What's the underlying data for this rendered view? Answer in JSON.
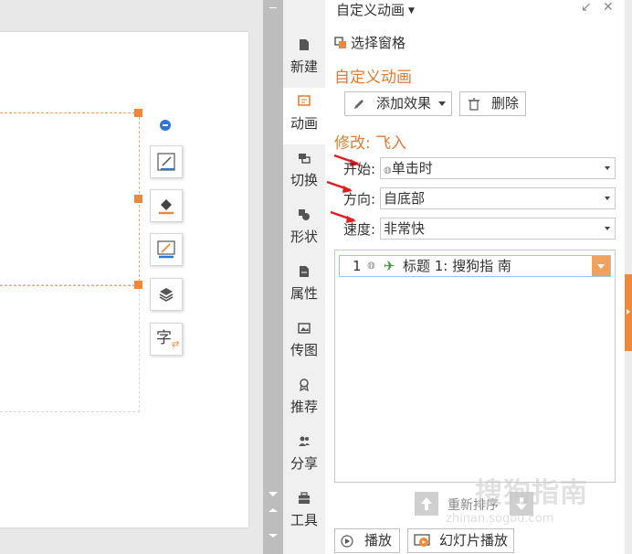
{
  "colors": {
    "accent": "#e07b31",
    "handle": "#f0883a",
    "focus": "#9ec3f0",
    "annotation": "#e02020"
  },
  "tabs": [
    {
      "label": "新建",
      "icon": "file-icon"
    },
    {
      "label": "动画",
      "icon": "animation-icon",
      "active": true
    },
    {
      "label": "切换",
      "icon": "transition-icon"
    },
    {
      "label": "形状",
      "icon": "shapes-icon"
    },
    {
      "label": "属性",
      "icon": "properties-icon"
    },
    {
      "label": "传图",
      "icon": "image-upload-icon"
    },
    {
      "label": "推荐",
      "icon": "recommend-icon"
    },
    {
      "label": "分享",
      "icon": "share-icon"
    },
    {
      "label": "工具",
      "icon": "toolbox-icon"
    }
  ],
  "pane": {
    "title": "自定义动画",
    "selection_pane_label": "选择窗格",
    "custom_animation_heading": "自定义动画",
    "add_effect_label": "添加效果",
    "delete_label": "删除",
    "modify_heading": "修改: 飞入",
    "start_label": "开始:",
    "start_value": "单击时",
    "direction_label": "方向:",
    "direction_value": "自底部",
    "speed_label": "速度:",
    "speed_value": "非常快",
    "list_items": [
      {
        "index": "1",
        "text": "标题 1: 搜狗指 南"
      }
    ],
    "reorder_label": "重新排序",
    "play_label": "播放",
    "slideshow_label": "幻灯片播放"
  },
  "floating_toolbar": [
    "fill-icon",
    "line-color-icon",
    "edit-icon",
    "layers-icon",
    "text-swap-icon"
  ],
  "float_text_glyph": "字",
  "watermark": {
    "main": "搜狗指南",
    "sub": "zhinan.sogou.com"
  }
}
